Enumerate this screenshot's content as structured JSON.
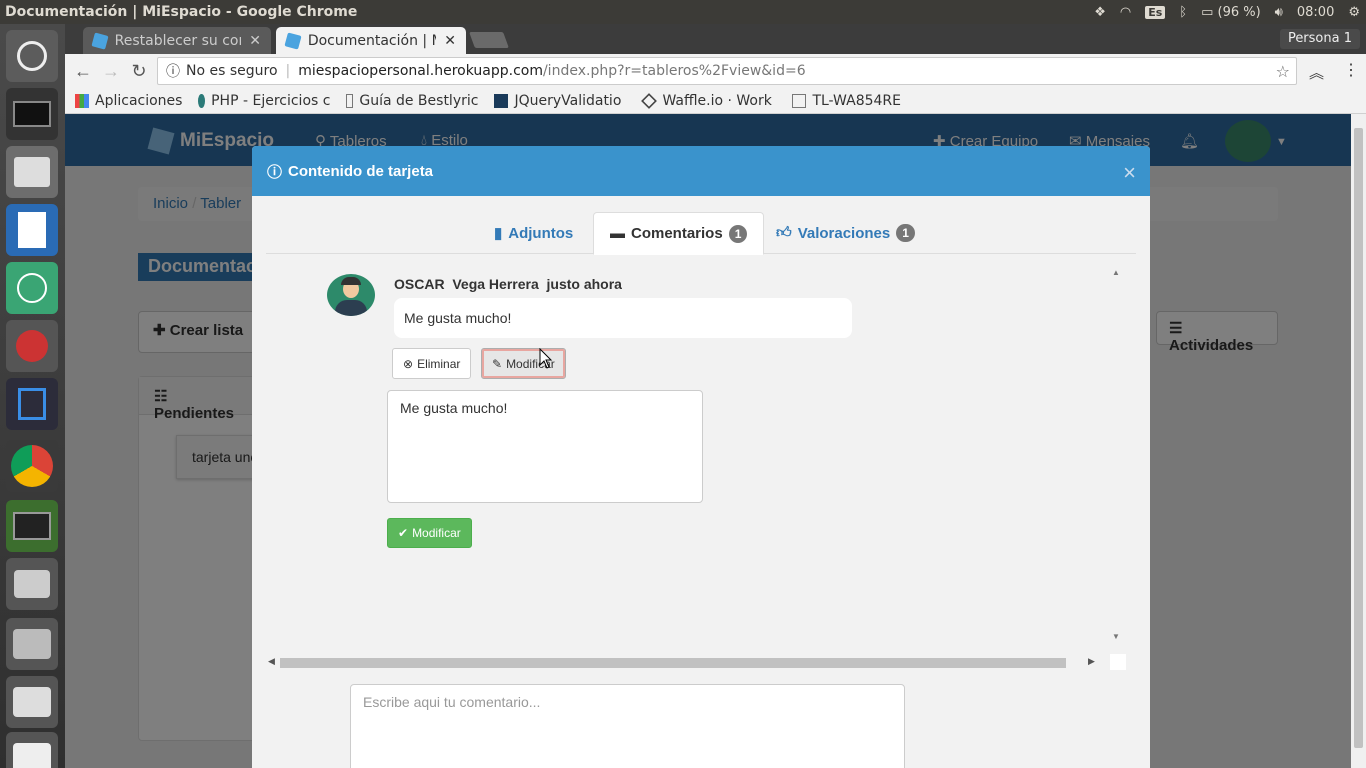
{
  "system": {
    "window_title": "Documentación | MiEspacio - Google Chrome",
    "keyboard_layout": "Es",
    "battery": "(96 %)",
    "clock": "08:00"
  },
  "browser": {
    "tabs": [
      {
        "title": "Restablecer su con"
      },
      {
        "title": "Documentación | M"
      }
    ],
    "profile": "Persona 1",
    "address": {
      "security": "No es seguro",
      "host": "miespaciopersonal.herokuapp.com",
      "path": "/index.php?r=tableros%2Fview&id=6"
    },
    "bookmarks": [
      {
        "label": "Aplicaciones"
      },
      {
        "label": "PHP - Ejercicios c"
      },
      {
        "label": "Guía de Bestlyric"
      },
      {
        "label": "JQueryValidatio"
      },
      {
        "label": "Waffle.io · Work"
      },
      {
        "label": "TL-WA854RE"
      }
    ]
  },
  "app": {
    "brand": "MiEspacio",
    "nav": {
      "boards": "Tableros",
      "style": "Estilo",
      "create_team": "Crear Equipo",
      "messages": "Mensajes"
    },
    "breadcrumb": {
      "home": "Inicio",
      "boards": "Tabler"
    },
    "board_title": "Documentac",
    "create_list": "Crear lista",
    "activities": "Actividades",
    "list_title": "Pendientes",
    "card_title": "tarjeta unc"
  },
  "modal": {
    "title": "Contenido de tarjeta",
    "tabs": [
      {
        "label": "Adjuntos"
      },
      {
        "label": "Comentarios",
        "count": "1"
      },
      {
        "label": "Valoraciones",
        "count": "1"
      }
    ],
    "comment": {
      "author": "OSCAR  Vega Herrera  justo ahora",
      "text": "Me gusta mucho!",
      "delete_label": "Eliminar",
      "edit_label": "Modificar",
      "edit_value": "Me gusta mucho!",
      "submit_label": "Modificar"
    },
    "new_comment_placeholder": "Escribe aqui tu comentario..."
  },
  "colors": {
    "navbar": "#2e6da4",
    "modal_header": "#3a93cc",
    "success": "#5cb85c"
  }
}
